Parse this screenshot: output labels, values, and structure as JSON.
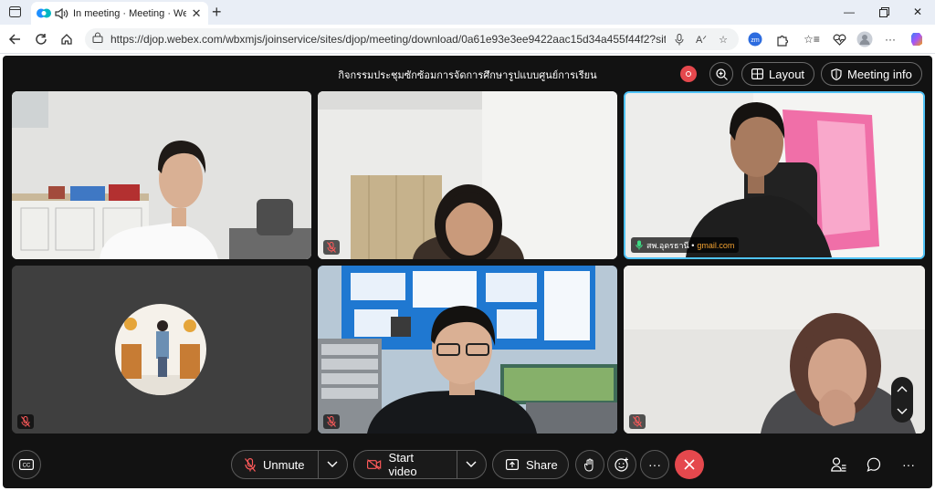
{
  "browser": {
    "tab_title": "In meeting · Meeting · Webex",
    "url": "https://djop.webex.com/wbxmjs/joinservice/sites/djop/meeting/download/0a61e93e3ee9422aac15d34a455f44f2?siteurl=...",
    "new_tab_glyph": "+",
    "more_glyph": "···"
  },
  "meeting": {
    "title": "กิจกรรมประชุมซักซ้อมการจัดการศึกษารูปแบบศูนย์การเรียน",
    "layout_label": "Layout",
    "meeting_info_label": "Meeting info"
  },
  "participants": [
    {
      "id": "p1",
      "label": "",
      "muted": false
    },
    {
      "id": "p2",
      "label": "",
      "muted": true
    },
    {
      "id": "p3",
      "label": "สพ.อุดรธานี •",
      "email": "gmail.com",
      "active_speaker": true
    },
    {
      "id": "p4",
      "label": "",
      "muted": true,
      "video_off": true
    },
    {
      "id": "p5",
      "label": "",
      "muted": true
    },
    {
      "id": "p6",
      "label": "",
      "muted": true
    }
  ],
  "controls": {
    "unmute_label": "Unmute",
    "start_video_label": "Start video",
    "share_label": "Share",
    "more_glyph": "···"
  },
  "colors": {
    "app_bg": "#121212",
    "leave_red": "#e5484d",
    "active_speaker_border": "#4fc3f7",
    "email_orange": "#f0a030"
  }
}
